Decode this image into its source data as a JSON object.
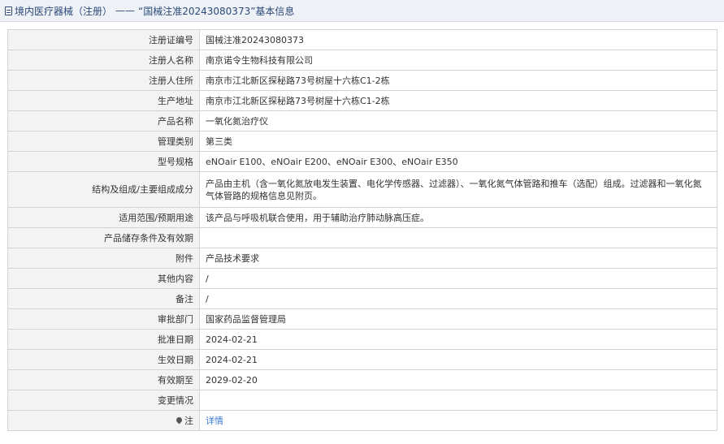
{
  "header": {
    "category": "境内医疗器械（注册）",
    "separator": "——",
    "title": "“国械注准20243080373”基本信息"
  },
  "rows": [
    {
      "label": "注册证编号",
      "value": "国械注准20243080373"
    },
    {
      "label": "注册人名称",
      "value": "南京诺令生物科技有限公司"
    },
    {
      "label": "注册人住所",
      "value": "南京市江北新区探秘路73号树屋十六栋C1-2栋"
    },
    {
      "label": "生产地址",
      "value": "南京市江北新区探秘路73号树屋十六栋C1-2栋"
    },
    {
      "label": "产品名称",
      "value": "一氧化氮治疗仪"
    },
    {
      "label": "管理类别",
      "value": "第三类"
    },
    {
      "label": "型号规格",
      "value": "eNOair E100、eNOair E200、eNOair E300、eNOair E350"
    },
    {
      "label": "结构及组成/主要组成成分",
      "value": "产品由主机（含一氧化氮放电发生装置、电化学传感器、过滤器）、一氧化氮气体管路和推车（选配）组成。过滤器和一氧化氮气体管路的规格信息见附页。"
    },
    {
      "label": "适用范围/预期用途",
      "value": "该产品与呼吸机联合使用，用于辅助治疗肺动脉高压症。"
    },
    {
      "label": "产品储存条件及有效期",
      "value": ""
    },
    {
      "label": "附件",
      "value": "产品技术要求"
    },
    {
      "label": "其他内容",
      "value": "/"
    },
    {
      "label": "备注",
      "value": "/"
    },
    {
      "label": "审批部门",
      "value": "国家药品监督管理局"
    },
    {
      "label": "批准日期",
      "value": "2024-02-21"
    },
    {
      "label": "生效日期",
      "value": "2024-02-21"
    },
    {
      "label": "有效期至",
      "value": "2029-02-20"
    },
    {
      "label": "变更情况",
      "value": ""
    }
  ],
  "note_row": {
    "label": "注",
    "link": "详情"
  }
}
